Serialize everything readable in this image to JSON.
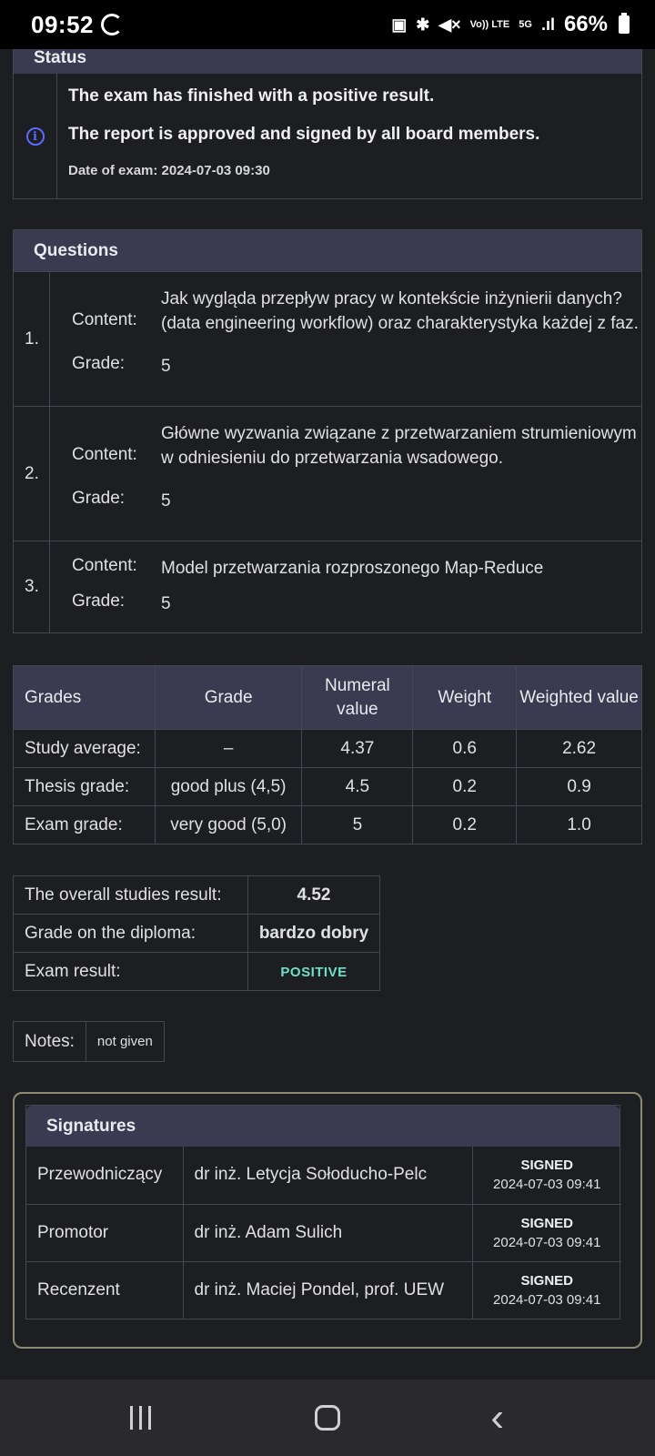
{
  "statusbar": {
    "time": "09:52",
    "network_label": "5G",
    "volte_label": "Vo)) LTE",
    "battery": "66%"
  },
  "status": {
    "title": "Status",
    "line1": "The exam has finished with a positive result.",
    "line2": "The report is approved and signed by all board members.",
    "date": "Date of exam: 2024-07-03 09:30"
  },
  "questions": {
    "title": "Questions",
    "content_label": "Content:",
    "grade_label": "Grade:",
    "items": [
      {
        "num": "1.",
        "content": "Jak wygląda przepływ pracy w kontekście inżynierii danych? (data engineering workflow) oraz charakterystyka każdej z faz.",
        "grade": "5"
      },
      {
        "num": "2.",
        "content": "Główne wyzwania związane z przetwarzaniem strumieniowym w odniesieniu do przetwarzania wsadowego.",
        "grade": "5"
      },
      {
        "num": "3.",
        "content": "Model przetwarzania rozproszonego Map-Reduce",
        "grade": "5"
      }
    ]
  },
  "grades": {
    "headers": [
      "Grades",
      "Grade",
      "Numeral value",
      "Weight",
      "Weighted value"
    ],
    "rows": [
      [
        "Study average:",
        "–",
        "4.37",
        "0.6",
        "2.62"
      ],
      [
        "Thesis grade:",
        "good plus (4,5)",
        "4.5",
        "0.2",
        "0.9"
      ],
      [
        "Exam grade:",
        "very good (5,0)",
        "5",
        "0.2",
        "1.0"
      ]
    ]
  },
  "overall": {
    "result_label": "The overall studies result:",
    "result_value": "4.52",
    "diploma_label": "Grade on the diploma:",
    "diploma_value": "bardzo dobry",
    "exam_label": "Exam result:",
    "exam_value": "POSITIVE"
  },
  "notes": {
    "label": "Notes:",
    "value": "not given"
  },
  "signatures": {
    "title": "Signatures",
    "rows": [
      {
        "role": "Przewodniczący",
        "name": "dr inż. Letycja Sołoducho-Pelc",
        "state": "SIGNED",
        "date": "2024-07-03 09:41"
      },
      {
        "role": "Promotor",
        "name": "dr inż. Adam Sulich",
        "state": "SIGNED",
        "date": "2024-07-03 09:41"
      },
      {
        "role": "Recenzent",
        "name": "dr inż. Maciej Pondel, prof. UEW",
        "state": "SIGNED",
        "date": "2024-07-03 09:41"
      }
    ]
  },
  "nav": {
    "back_glyph": "‹"
  }
}
